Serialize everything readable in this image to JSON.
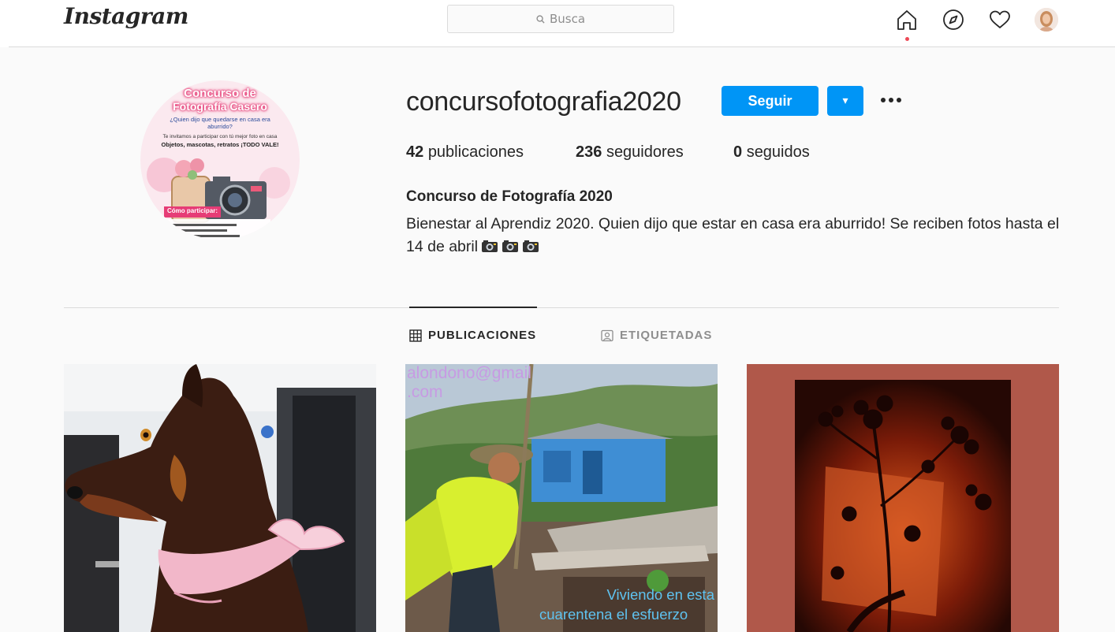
{
  "nav": {
    "logo": "Instagram",
    "search_placeholder": "Busca",
    "icons": [
      "home-icon",
      "explore-compass-icon",
      "heart-icon",
      "profile-avatar"
    ]
  },
  "profile": {
    "username": "concursofotografia2020",
    "follow_label": "Seguir",
    "dropdown_icon": "▾",
    "stats": [
      {
        "count": "42",
        "label": "publicaciones"
      },
      {
        "count": "236",
        "label": "seguidores"
      },
      {
        "count": "0",
        "label": "seguidos"
      }
    ],
    "full_name": "Concurso de Fotografía 2020",
    "bio": "Bienestar al Aprendiz 2020. Quien dijo que estar en casa era aburrido! Se reciben fotos hasta el 14 de abril",
    "bio_emoji": "camera-emoji x3",
    "avatar_text": {
      "title_line1": "Concurso de",
      "title_line2": "Fotografía Casero",
      "question": "¿Quien dijo que quedarse en casa era aburrido?",
      "invite": "Te invitamos a participar con tú mejor foto en casa",
      "categories": "Objetos, mascotas, retratos ¡TODO VALE!",
      "how": "Cómo participar:"
    }
  },
  "tabs": [
    {
      "label": "PUBLICACIONES",
      "active": true
    },
    {
      "label": "ETIQUETADAS",
      "active": false
    }
  ],
  "posts": [
    {
      "description": "dog-photo"
    },
    {
      "overlay_top": "alondono@gmail .com",
      "overlay_bottom_1": "Viviendo en esta",
      "overlay_bottom_2": "cuarentena el esfuerzo"
    },
    {
      "description": "flower-shadow-photo"
    }
  ],
  "colors": {
    "accent": "#0095f6",
    "notification_dot": "#ed4956",
    "border": "#dbdbdb",
    "muted": "#8e8e8e"
  }
}
